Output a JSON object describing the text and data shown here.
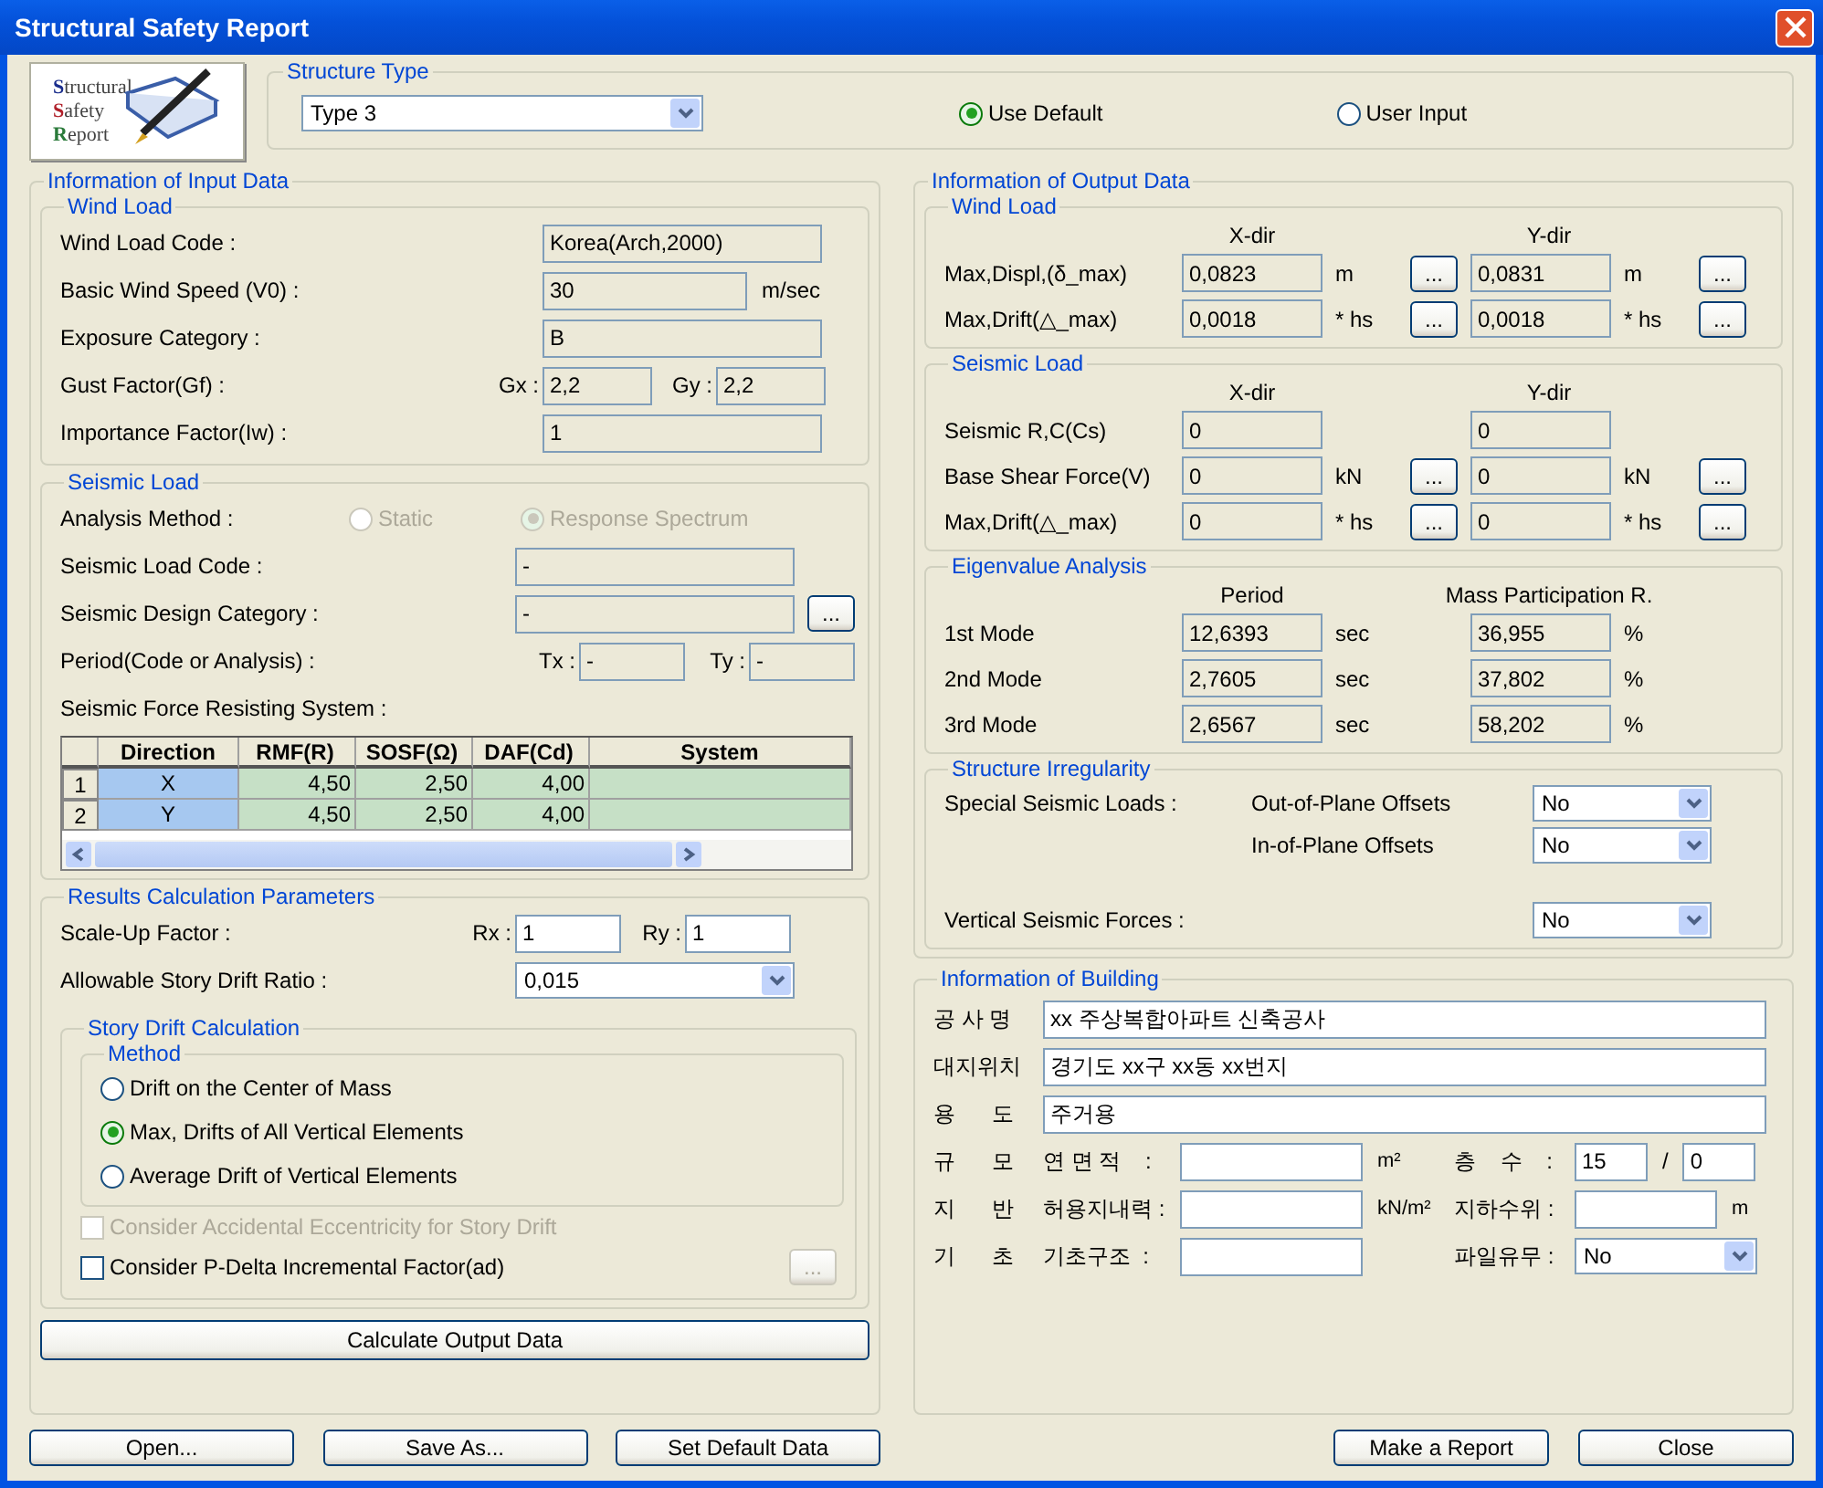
{
  "window": {
    "title": "Structural Safety Report"
  },
  "logo": {
    "lines": [
      "Structural",
      "Safety",
      "Report"
    ]
  },
  "structure_type": {
    "title": "Structure Type",
    "value": "Type 3",
    "options": [
      {
        "label": "Use Default",
        "selected": true
      },
      {
        "label": "User Input",
        "selected": false
      }
    ]
  },
  "input": {
    "title": "Information of Input Data",
    "wind": {
      "title": "Wind Load",
      "readonly": true,
      "rows": [
        {
          "kind": "field",
          "label": "Wind Load Code :",
          "value": "Korea(Arch,2000)"
        },
        {
          "kind": "field",
          "label": "Basic Wind Speed (V0) :",
          "value": "30",
          "unit": "m/sec"
        },
        {
          "kind": "field",
          "label": "Exposure Category :",
          "value": "B"
        },
        {
          "kind": "pair",
          "label": "Gust Factor(Gf) :",
          "pairs": [
            {
              "label": "Gx :",
              "value": "2,2"
            },
            {
              "label": "Gy :",
              "value": "2,2"
            }
          ]
        },
        {
          "kind": "field",
          "label": "Importance Factor(Iw) :",
          "value": "1"
        }
      ]
    },
    "seismic": {
      "title": "Seismic Load",
      "readonly": true,
      "analysis": {
        "label": "Analysis Method :",
        "disabled": true,
        "options": [
          {
            "label": "Static",
            "selected": false
          },
          {
            "label": "Response Spectrum",
            "selected": true
          }
        ]
      },
      "rows": [
        {
          "kind": "field",
          "label": "Seismic Load Code :",
          "value": "-"
        },
        {
          "kind": "field",
          "label": "Seismic Design Category :",
          "value": "-",
          "button": "..."
        },
        {
          "kind": "pair",
          "label": "Period(Code or Analysis) :",
          "pairs": [
            {
              "label": "Tx :",
              "value": "-"
            },
            {
              "label": "Ty :",
              "value": "-"
            }
          ]
        }
      ],
      "system_label": "Seismic Force Resisting System :",
      "table": {
        "columns": [
          "Direction",
          "RMF(R)",
          "SOSF(Ω)",
          "DAF(Cd)",
          "System"
        ],
        "rows": [
          {
            "index": "1",
            "cells": [
              "X",
              "4,50",
              "2,50",
              "4,00"
            ]
          },
          {
            "index": "2",
            "cells": [
              "Y",
              "4,50",
              "2,50",
              "4,00"
            ]
          }
        ]
      }
    },
    "results": {
      "title": "Results Calculation Parameters",
      "readonly": false,
      "scale": {
        "label": "Scale-Up Factor :",
        "pairs": [
          {
            "label": "Rx :",
            "value": "1"
          },
          {
            "label": "Ry :",
            "value": "1"
          }
        ]
      },
      "drift_ratio": {
        "label": "Allowable Story Drift Ratio :",
        "value": "0,015"
      },
      "story_drift": {
        "title": "Story Drift Calculation",
        "method_title": "Method",
        "methods": [
          {
            "label": "Drift on the Center of Mass",
            "selected": false
          },
          {
            "label": "Max, Drifts of All Vertical Elements",
            "selected": true
          },
          {
            "label": "Average Drift of Vertical Elements",
            "selected": false
          }
        ],
        "checks": [
          {
            "label": "Consider Accidental Eccentricity for Story Drift",
            "checked": false,
            "disabled": true
          },
          {
            "label": "Consider P-Delta Incremental Factor(ad)",
            "checked": false,
            "disabled": false,
            "button": "...",
            "button_disabled": true
          }
        ]
      }
    },
    "calculate_button": "Calculate Output Data"
  },
  "output": {
    "title": "Information of Output Data",
    "readonly": true,
    "sections": [
      {
        "title": "Wind Load",
        "headers": [
          "X-dir",
          "Y-dir"
        ],
        "rows": [
          {
            "label": "Max,Displ,(δ_max)",
            "cols": [
              {
                "value": "0,0823",
                "unit": "m",
                "button": "..."
              },
              {
                "value": "0,0831",
                "unit": "m",
                "button": "..."
              }
            ]
          },
          {
            "label": "Max,Drift(△_max)",
            "cols": [
              {
                "value": "0,0018",
                "unit": "* hs",
                "button": "..."
              },
              {
                "value": "0,0018",
                "unit": "* hs",
                "button": "..."
              }
            ]
          }
        ]
      },
      {
        "title": "Seismic Load",
        "headers": [
          "X-dir",
          "Y-dir"
        ],
        "rows": [
          {
            "label": "Seismic R,C(Cs)",
            "cols": [
              {
                "value": "0"
              },
              {
                "value": "0"
              }
            ]
          },
          {
            "label": "Base Shear Force(V)",
            "cols": [
              {
                "value": "0",
                "unit": "kN",
                "button": "..."
              },
              {
                "value": "0",
                "unit": "kN",
                "button": "..."
              }
            ]
          },
          {
            "label": "Max,Drift(△_max)",
            "cols": [
              {
                "value": "0",
                "unit": "* hs",
                "button": "..."
              },
              {
                "value": "0",
                "unit": "* hs",
                "button": "..."
              }
            ]
          }
        ]
      },
      {
        "title": "Eigenvalue Analysis",
        "headers": [
          "Period",
          "Mass Participation R."
        ],
        "rows": [
          {
            "label": "1st  Mode",
            "cols": [
              {
                "value": "12,6393",
                "unit": "sec"
              },
              {
                "value": "36,955",
                "unit": "%"
              }
            ]
          },
          {
            "label": "2nd Mode",
            "cols": [
              {
                "value": "2,7605",
                "unit": "sec"
              },
              {
                "value": "37,802",
                "unit": "%"
              }
            ]
          },
          {
            "label": "3rd  Mode",
            "cols": [
              {
                "value": "2,6567",
                "unit": "sec"
              },
              {
                "value": "58,202",
                "unit": "%"
              }
            ]
          }
        ]
      }
    ],
    "irregularity": {
      "title": "Structure Irregularity",
      "rows": [
        {
          "label": "Special Seismic Loads :",
          "sublabel": "Out-of-Plane Offsets",
          "value": "No"
        },
        {
          "sublabel": "In-of-Plane Offsets",
          "value": "No"
        },
        {
          "label": "Vertical Seismic Forces :",
          "value": "No"
        }
      ]
    }
  },
  "building": {
    "title": "Information of Building",
    "rows": [
      {
        "kind": "wide",
        "label": "공 사 명",
        "value": "xx 주상복합아파트 신축공사"
      },
      {
        "kind": "wide",
        "label": "대지위치",
        "value": "경기도 xx구 xx동 xx번지"
      },
      {
        "kind": "wide",
        "label": "용      도",
        "value": "주거용"
      },
      {
        "kind": "split",
        "label": "규      모",
        "items": [
          {
            "kind": "field",
            "label": "연 면 적    :",
            "unit": "m²"
          },
          {
            "kind": "pair",
            "label": "층    수    :",
            "values": [
              "15",
              "0"
            ],
            "separator": "/"
          }
        ]
      },
      {
        "kind": "split",
        "label": "지      반",
        "items": [
          {
            "kind": "field",
            "label": "허용지내력 :",
            "unit": "kN/m²"
          },
          {
            "kind": "field",
            "label": "지하수위 :",
            "unit": "m"
          }
        ]
      },
      {
        "kind": "split",
        "label": "기      초",
        "items": [
          {
            "kind": "field",
            "label": "기초구조  :"
          },
          {
            "kind": "select",
            "label": "파일유무 :",
            "value": "No"
          }
        ]
      }
    ]
  },
  "buttons": {
    "left": [
      "Open...",
      "Save As...",
      "Set Default Data"
    ],
    "right": [
      "Make a Report",
      "Close"
    ]
  }
}
